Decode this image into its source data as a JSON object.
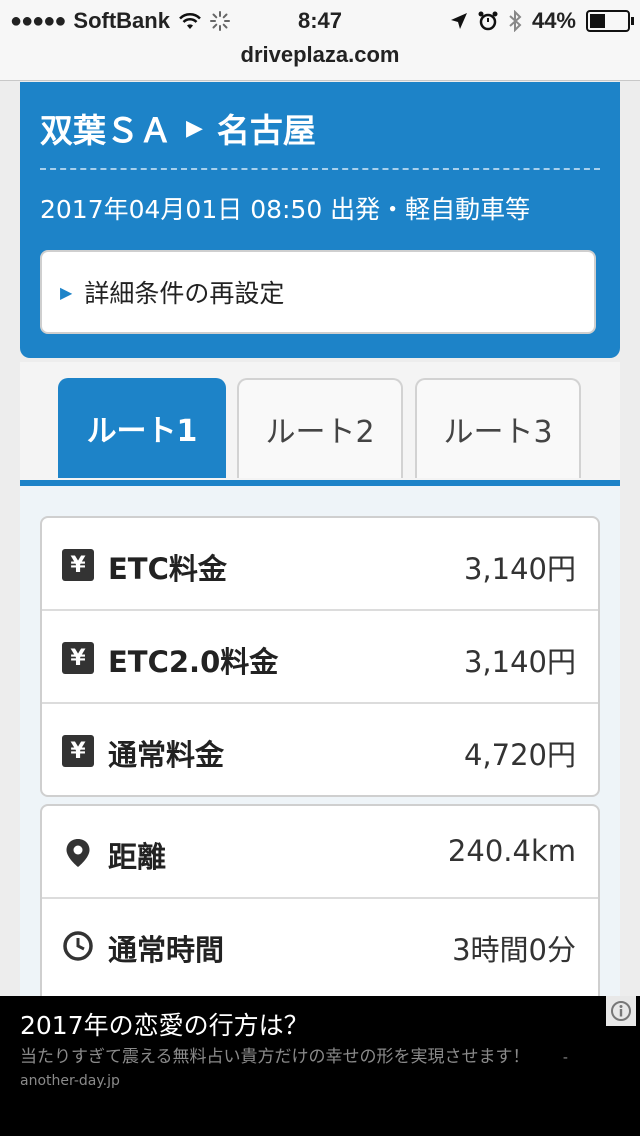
{
  "status_bar": {
    "carrier": "SoftBank",
    "time": "8:47",
    "battery": "44%",
    "battery_level": 0.44
  },
  "url_bar": {
    "domain": "driveplaza.com"
  },
  "route": {
    "from": "双葉ＳＡ",
    "to": "名古屋",
    "info": "2017年04月01日 08:50 出発・軽自動車等",
    "reset_label": "詳細条件の再設定"
  },
  "tabs": [
    {
      "label": "ルート1",
      "active": true
    },
    {
      "label": "ルート2",
      "active": false
    },
    {
      "label": "ルート3",
      "active": false
    }
  ],
  "fees": [
    {
      "icon": "yen-icon",
      "label": "ETC料金",
      "value": "3,140円"
    },
    {
      "icon": "yen-icon",
      "label": "ETC2.0料金",
      "value": "3,140円"
    },
    {
      "icon": "yen-icon",
      "label": "通常料金",
      "value": "4,720円"
    }
  ],
  "details": [
    {
      "icon": "location-pin-icon",
      "label": "距離",
      "value": "240.4km"
    },
    {
      "icon": "clock-icon",
      "label": "通常時間",
      "value": "3時間0分"
    }
  ],
  "ad": {
    "title": "2017年の恋愛の行方は？",
    "description": "当たりすぎて震える無料占い貴方だけの幸せの形を実現させます！",
    "domain": "- another-day.jp"
  },
  "colors": {
    "accent": "#1d83c8"
  }
}
